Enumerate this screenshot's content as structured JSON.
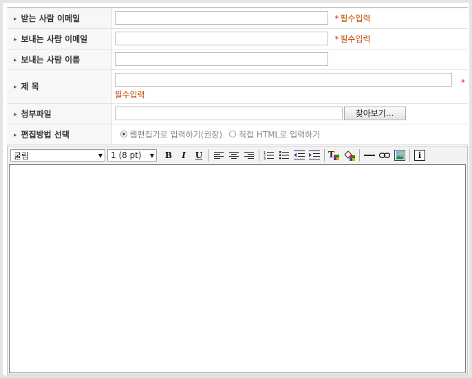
{
  "form": {
    "rows": {
      "to_email": {
        "label": "받는 사람 이메일",
        "required": "필수입력",
        "value": ""
      },
      "from_email": {
        "label": "보내는 사람 이메일",
        "required": "필수입력",
        "value": ""
      },
      "from_name": {
        "label": "보내는 사람 이름",
        "value": ""
      },
      "subject": {
        "label": "제 목",
        "required": "필수입력",
        "star": "*",
        "value": ""
      },
      "attachment": {
        "label": "첨부파일",
        "button": "찾아보기...",
        "value": ""
      },
      "edit_mode": {
        "label": "편집방법 선택",
        "option_web": "웹편집기로 입력하기(권장)",
        "option_html": "직접 HTML로 입력하기",
        "selected": "web"
      }
    },
    "star_mark": "*"
  },
  "editor": {
    "font_family": "굴림",
    "font_size": "1 (8 pt)",
    "buttons": {
      "bold": "B",
      "italic": "I",
      "underline": "U",
      "info": "i"
    },
    "content": ""
  },
  "colors": {
    "required": "#c74a00",
    "star": "#dd2222",
    "label_bg": "#f7f7f7",
    "frame": "#e4e4e4"
  },
  "icons": [
    "bullet-arrow-icon",
    "align-left-icon",
    "align-center-icon",
    "align-right-icon",
    "ordered-list-icon",
    "unordered-list-icon",
    "outdent-icon",
    "indent-icon",
    "text-color-icon",
    "background-color-icon",
    "horizontal-rule-icon",
    "link-icon",
    "image-icon",
    "info-icon"
  ]
}
